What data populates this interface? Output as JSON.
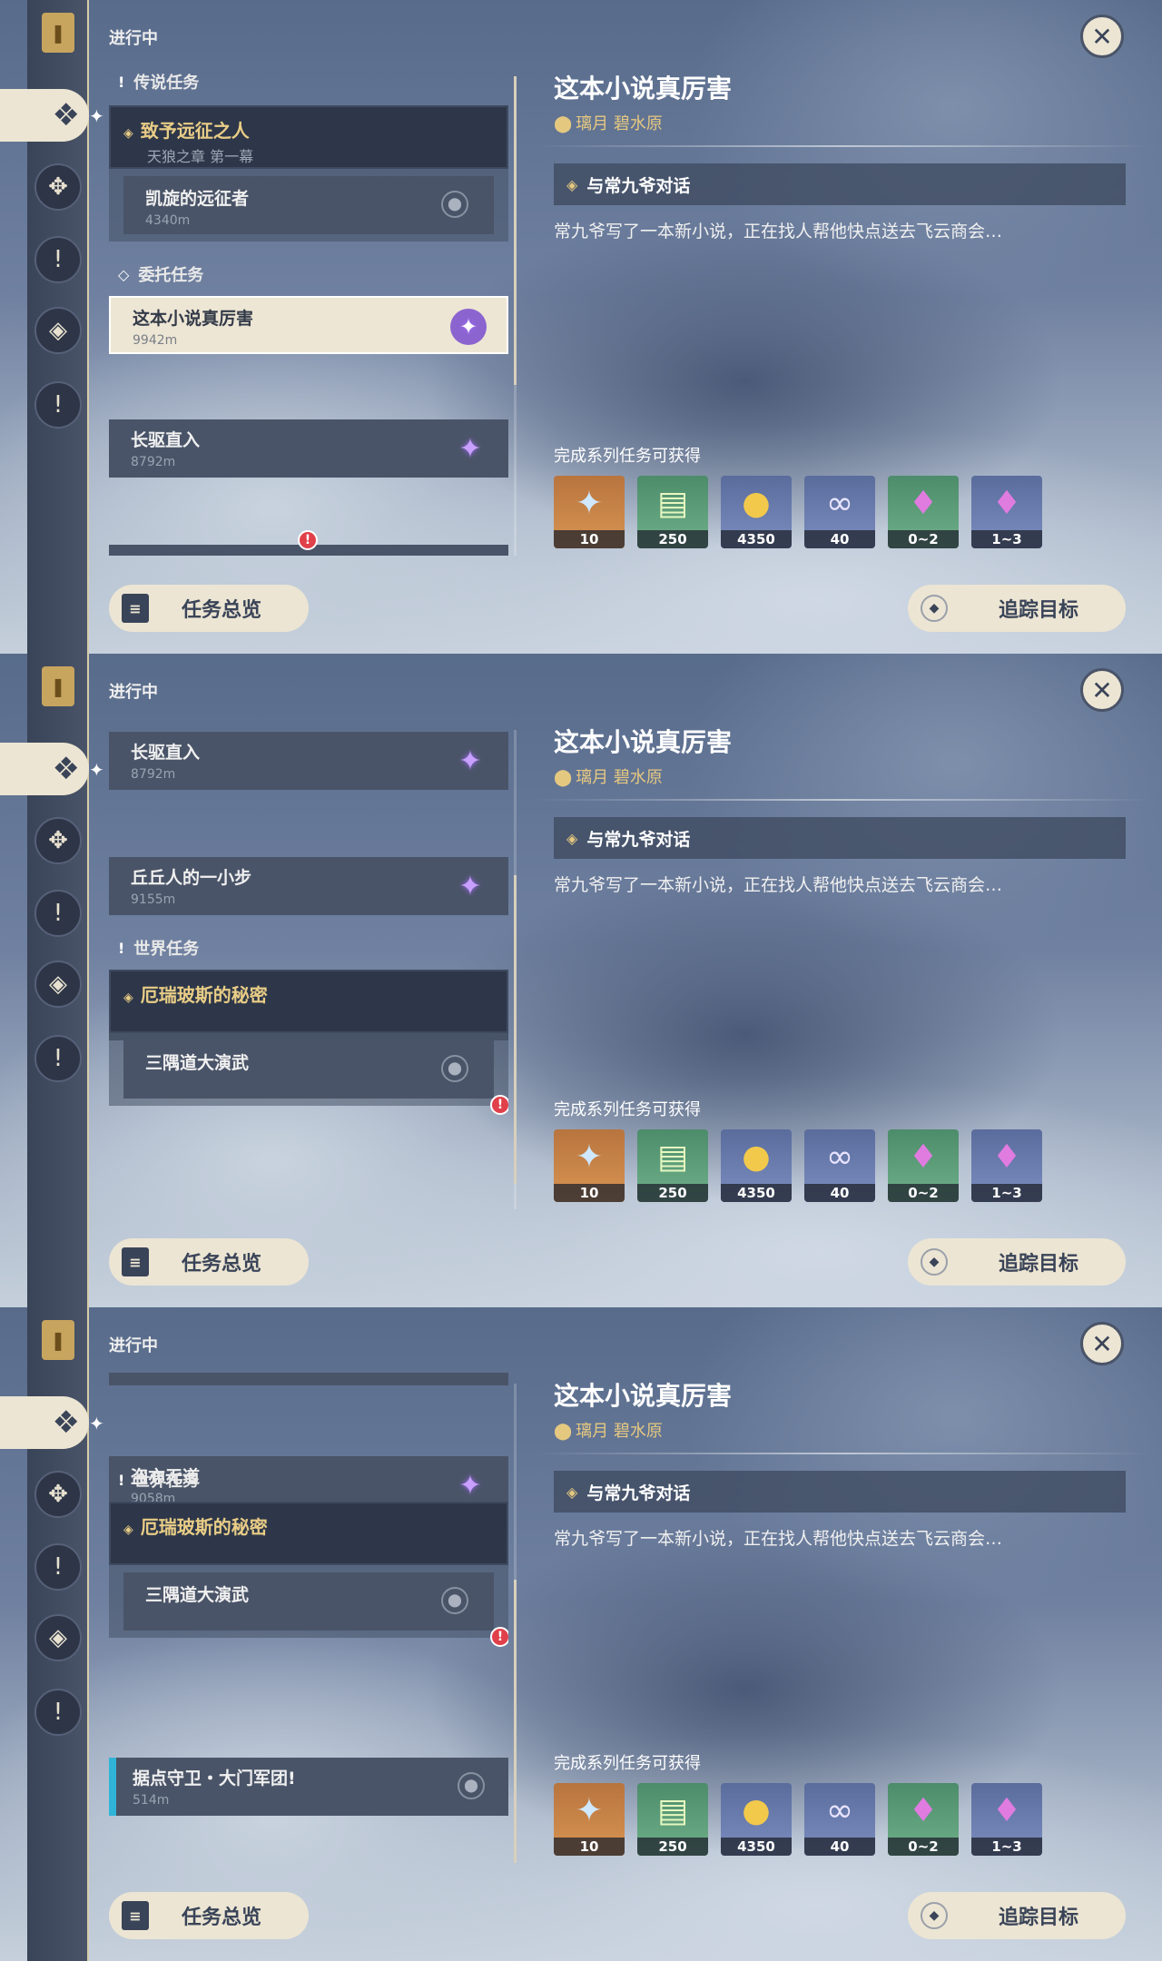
{
  "header": {
    "status": "进行中"
  },
  "detail": {
    "title": "这本小说真厉害",
    "location_region": "璃月",
    "location_area": "碧水原",
    "objective": "与常九爷对话",
    "description": "常九爷写了一本新小说，正在找人帮他快点送去飞云商会…",
    "rewards_label": "完成系列任务可获得",
    "rewards": [
      {
        "icon": "primogem-icon",
        "qty": "10"
      },
      {
        "icon": "adventure-exp-icon",
        "qty": "250"
      },
      {
        "icon": "mora-icon",
        "qty": "4350"
      },
      {
        "icon": "companionship-exp-icon",
        "qty": "40"
      },
      {
        "icon": "crystal-green-icon",
        "qty": "0~2"
      },
      {
        "icon": "crystal-purple-icon",
        "qty": "1~3"
      }
    ]
  },
  "buttons": {
    "overview": "任务总览",
    "track": "追踪目标"
  },
  "categories": {
    "archon": "传说任务",
    "commission": "委托任务",
    "world": "世界任务"
  },
  "quests": {
    "archon_title": "致予远征之人",
    "archon_sub": "天狼之章 第一幕",
    "archon_step": "凯旋的远征者",
    "archon_step_dist": "4340m",
    "world_title": "厄瑞玻斯的秘密",
    "world_step": "三隅道大演武"
  },
  "commissions": [
    {
      "name": "这本小说真厉害",
      "dist": "9942m"
    },
    {
      "name": "长驱直入",
      "dist": "8792m"
    },
    {
      "name": "丘丘人的一小步",
      "dist": "9155m"
    },
    {
      "name": "盗亦无道",
      "dist": "9058m"
    }
  ],
  "domain_quest": {
    "name": "据点守卫・大门军团!",
    "dist": "514m"
  },
  "partial_dist": "9155m"
}
